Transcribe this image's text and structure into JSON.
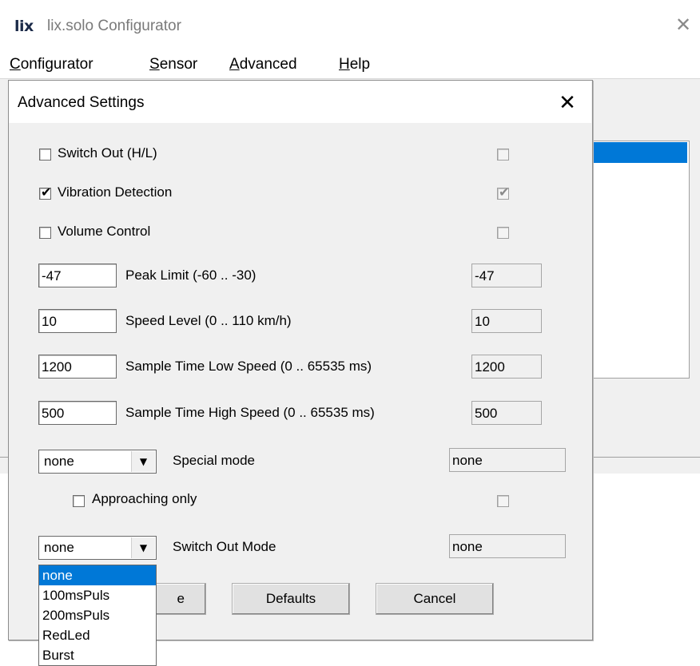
{
  "app": {
    "logo": "lix",
    "title": "lix.solo Configurator"
  },
  "menu": [
    {
      "u": "C",
      "rest": "onfigurator"
    },
    {
      "u": "S",
      "rest": "ensor"
    },
    {
      "u": "A",
      "rest": "dvanced"
    },
    {
      "u": "H",
      "rest": "elp"
    }
  ],
  "dialog": {
    "title": "Advanced Settings",
    "switch_out": {
      "label": "Switch Out (H/L)",
      "checked": false,
      "current": false
    },
    "vibration": {
      "label": "Vibration Detection",
      "checked": true,
      "current": true
    },
    "volume": {
      "label": "Volume Control",
      "checked": false,
      "current": false
    },
    "peak_limit": {
      "value": "-47",
      "label": "Peak Limit (-60 .. -30)",
      "current": "-47"
    },
    "speed_level": {
      "value": "10",
      "label": "Speed Level (0 .. 110 km/h)",
      "current": "10"
    },
    "sample_low": {
      "value": "1200",
      "label": "Sample Time Low Speed (0 .. 65535 ms)",
      "current": "1200"
    },
    "sample_high": {
      "value": "500",
      "label": "Sample Time High Speed (0 .. 65535 ms)",
      "current": "500"
    },
    "special_mode": {
      "value": "none",
      "label": "Special mode",
      "current": "none"
    },
    "approaching": {
      "label": "Approaching only",
      "checked": false,
      "current": false
    },
    "switch_out_mode": {
      "value": "none",
      "label": "Switch Out Mode",
      "current": "none",
      "options": [
        "none",
        "100msPuls",
        "200msPuls",
        "RedLed",
        "Burst"
      ],
      "selected_index": 0
    },
    "buttons": {
      "save_partial": "e",
      "defaults": "Defaults",
      "cancel": "Cancel"
    }
  },
  "icons": {
    "close": "close-icon",
    "combo_arrow": "chevron-down-icon",
    "check": "checkmark-icon"
  },
  "colors": {
    "selection": "#0078d7",
    "dialog_bg": "#f0f0f0"
  }
}
